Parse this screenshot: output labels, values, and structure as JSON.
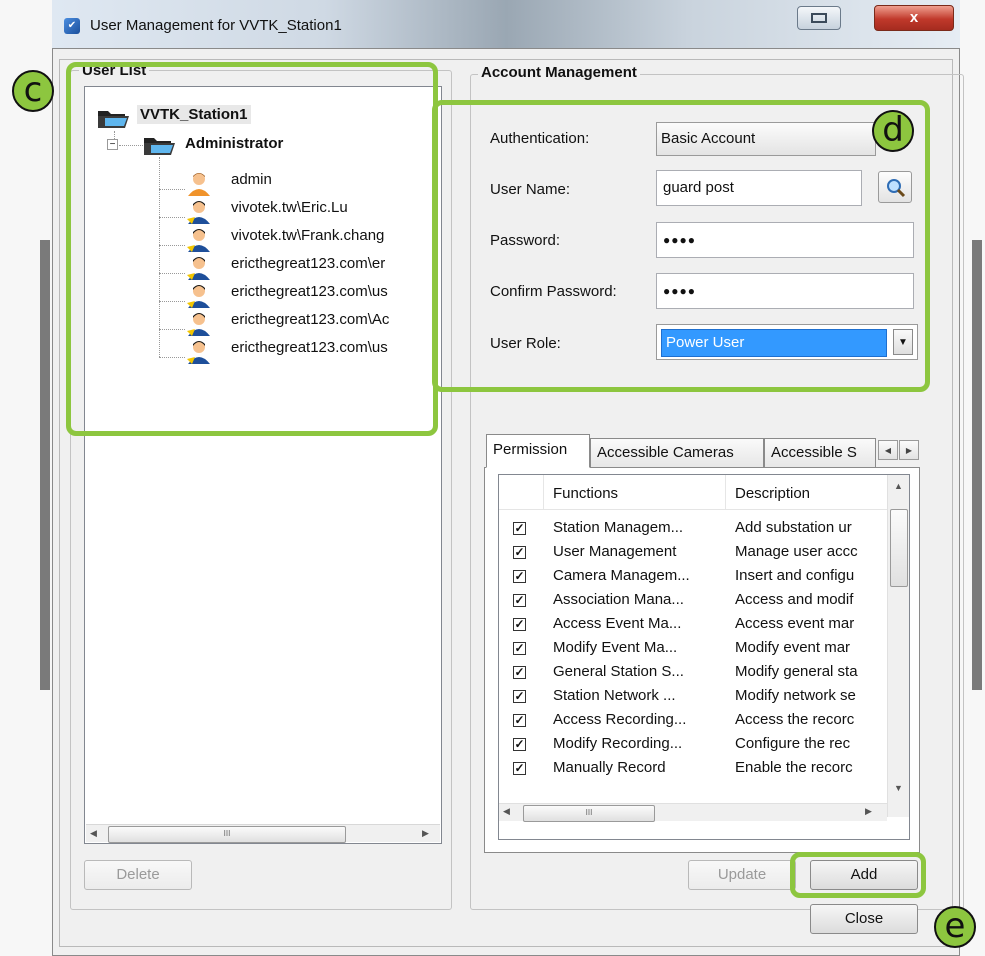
{
  "window": {
    "title": "User Management for VVTK_Station1",
    "close_glyph": "x"
  },
  "user_list": {
    "label": "User List",
    "root": "VVTK_Station1",
    "group": "Administrator",
    "users": [
      "admin",
      "vivotek.tw\\Eric.Lu",
      "vivotek.tw\\Frank.chang",
      "ericthegreat123.com\\er",
      "ericthegreat123.com\\us",
      "ericthegreat123.com\\Ac",
      "ericthegreat123.com\\us"
    ],
    "delete_label": "Delete"
  },
  "account": {
    "label": "Account Management",
    "authentication_label": "Authentication:",
    "authentication_value": "Basic Account",
    "username_label": "User Name:",
    "username_value": "guard post",
    "password_label": "Password:",
    "password_value": "●●●●",
    "confirm_label": "Confirm Password:",
    "confirm_value": "●●●●",
    "role_label": "User Role:",
    "role_value": "Power User"
  },
  "tabs": [
    "Permission",
    "Accessible Cameras",
    "Accessible S"
  ],
  "permissions": {
    "col_functions": "Functions",
    "col_description": "Description",
    "rows": [
      {
        "function": "Station Managem...",
        "description": "Add substation ur",
        "checked": true
      },
      {
        "function": "User Management",
        "description": "Manage user accc",
        "checked": true
      },
      {
        "function": "Camera Managem...",
        "description": "Insert and configu",
        "checked": true
      },
      {
        "function": "Association Mana...",
        "description": "Access and modif",
        "checked": true
      },
      {
        "function": "Access Event Ma...",
        "description": "Access event mar",
        "checked": true
      },
      {
        "function": "Modify Event Ma...",
        "description": "Modify event mar",
        "checked": true
      },
      {
        "function": "General Station S...",
        "description": "Modify general sta",
        "checked": true
      },
      {
        "function": "Station Network ...",
        "description": "Modify network se",
        "checked": true
      },
      {
        "function": "Access Recording...",
        "description": "Access the recorc",
        "checked": true
      },
      {
        "function": "Modify Recording...",
        "description": "Configure the rec",
        "checked": true
      },
      {
        "function": "Manually Record",
        "description": "Enable the recorc",
        "checked": true
      }
    ]
  },
  "buttons": {
    "update": "Update",
    "add": "Add",
    "close": "Close"
  },
  "glyphs": {
    "check": "✓",
    "scroll_left": "◀",
    "scroll_right": "▶",
    "scroll_up": "▲",
    "scroll_down": "▼",
    "thumb_grip": "III",
    "dropdown": "▼"
  },
  "callouts": {
    "c": "c",
    "d": "d",
    "e": "e"
  },
  "colors": {
    "callout": "#8dc63f",
    "selection": "#3399ff",
    "title_close": "#c0392b"
  }
}
